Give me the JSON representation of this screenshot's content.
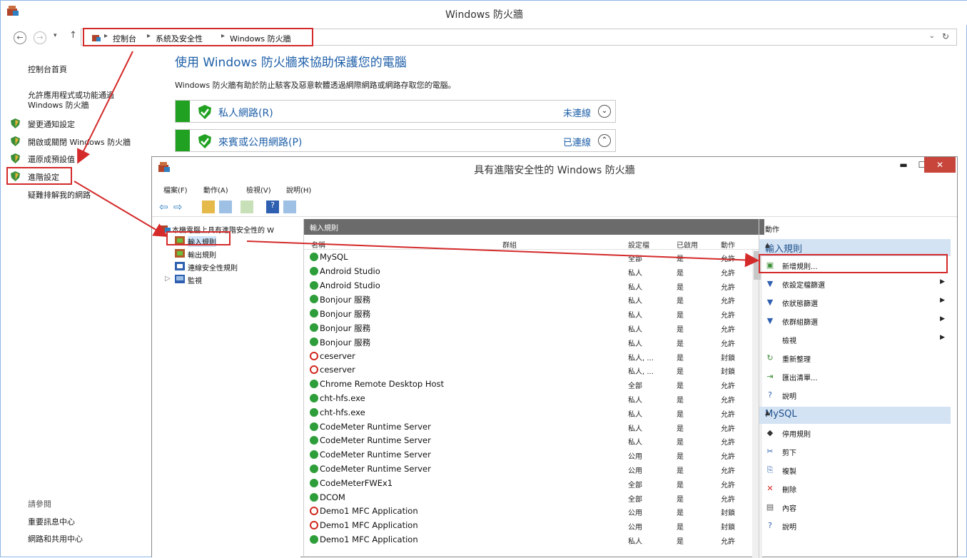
{
  "outer_window": {
    "title": "Windows 防火牆",
    "breadcrumb": [
      "控制台",
      "系統及安全性",
      "Windows 防火牆"
    ],
    "left_nav": {
      "home": "控制台首頁",
      "allow_app": "允許應用程式或功能通過 Windows 防火牆",
      "change_notify": "變更通知設定",
      "toggle_fw": "開啟或關閉 Windows 防火牆",
      "restore": "還原成預設值",
      "advanced": "進階設定",
      "troubleshoot": "疑難排解我的網路",
      "see_also": "請參閱",
      "security_center": "重要訊息中心",
      "network_center": "網路和共用中心"
    },
    "heading": "使用 Windows 防火牆來協助保護您的電腦",
    "description": "Windows 防火牆有助於防止駭客及惡意軟體透過網際網路或網路存取您的電腦。",
    "networks": [
      {
        "name": "私人網路(R)",
        "status": "未連線",
        "chevron": "⌄"
      },
      {
        "name": "來賓或公用網路(P)",
        "status": "已連線",
        "chevron": "⌃"
      }
    ]
  },
  "inner_window": {
    "title": "具有進階安全性的 Windows 防火牆",
    "menus": [
      "檔案(F)",
      "動作(A)",
      "檢視(V)",
      "說明(H)"
    ],
    "tree": {
      "root": "本機電腦上具有進階安全性的 W",
      "inbound": "輸入規則",
      "outbound": "輸出規則",
      "connection": "連線安全性規則",
      "monitor": "監視"
    },
    "rules_header": "輸入規則",
    "columns": {
      "name": "名稱",
      "group": "群組",
      "profile": "設定檔",
      "enabled": "已啟用",
      "action": "動作"
    },
    "rules": [
      {
        "name": "MySQL",
        "profile": "全部",
        "enabled": "是",
        "action": "允許",
        "type": "allow"
      },
      {
        "name": "Android Studio",
        "profile": "私人",
        "enabled": "是",
        "action": "允許",
        "type": "allow"
      },
      {
        "name": "Android Studio",
        "profile": "私人",
        "enabled": "是",
        "action": "允許",
        "type": "allow"
      },
      {
        "name": "Bonjour 服務",
        "profile": "私人",
        "enabled": "是",
        "action": "允許",
        "type": "allow"
      },
      {
        "name": "Bonjour 服務",
        "profile": "私人",
        "enabled": "是",
        "action": "允許",
        "type": "allow"
      },
      {
        "name": "Bonjour 服務",
        "profile": "私人",
        "enabled": "是",
        "action": "允許",
        "type": "allow"
      },
      {
        "name": "Bonjour 服務",
        "profile": "私人",
        "enabled": "是",
        "action": "允許",
        "type": "allow"
      },
      {
        "name": "ceserver",
        "profile": "私人, ...",
        "enabled": "是",
        "action": "封鎖",
        "type": "block"
      },
      {
        "name": "ceserver",
        "profile": "私人, ...",
        "enabled": "是",
        "action": "封鎖",
        "type": "block"
      },
      {
        "name": "Chrome Remote Desktop Host",
        "profile": "全部",
        "enabled": "是",
        "action": "允許",
        "type": "allow"
      },
      {
        "name": "cht-hfs.exe",
        "profile": "私人",
        "enabled": "是",
        "action": "允許",
        "type": "allow"
      },
      {
        "name": "cht-hfs.exe",
        "profile": "私人",
        "enabled": "是",
        "action": "允許",
        "type": "allow"
      },
      {
        "name": "CodeMeter Runtime Server",
        "profile": "私人",
        "enabled": "是",
        "action": "允許",
        "type": "allow"
      },
      {
        "name": "CodeMeter Runtime Server",
        "profile": "私人",
        "enabled": "是",
        "action": "允許",
        "type": "allow"
      },
      {
        "name": "CodeMeter Runtime Server",
        "profile": "公用",
        "enabled": "是",
        "action": "允許",
        "type": "allow"
      },
      {
        "name": "CodeMeter Runtime Server",
        "profile": "公用",
        "enabled": "是",
        "action": "允許",
        "type": "allow"
      },
      {
        "name": "CodeMeterFWEx1",
        "profile": "全部",
        "enabled": "是",
        "action": "允許",
        "type": "allow"
      },
      {
        "name": "DCOM",
        "profile": "全部",
        "enabled": "是",
        "action": "允許",
        "type": "allow"
      },
      {
        "name": "Demo1 MFC Application",
        "profile": "公用",
        "enabled": "是",
        "action": "封鎖",
        "type": "block"
      },
      {
        "name": "Demo1 MFC Application",
        "profile": "公用",
        "enabled": "是",
        "action": "封鎖",
        "type": "block"
      },
      {
        "name": "Demo1 MFC Application",
        "profile": "私人",
        "enabled": "是",
        "action": "允許",
        "type": "allow"
      }
    ],
    "actions": {
      "header": "動作",
      "section1": "輸入規則",
      "items1": [
        {
          "label": "新增規則...",
          "icon": "new-rule-icon"
        },
        {
          "label": "依設定檔篩選",
          "icon": "filter-icon"
        },
        {
          "label": "依狀態篩選",
          "icon": "filter-icon"
        },
        {
          "label": "依群組篩選",
          "icon": "filter-icon"
        },
        {
          "label": "檢視",
          "icon": ""
        },
        {
          "label": "重新整理",
          "icon": "refresh-icon"
        },
        {
          "label": "匯出清單...",
          "icon": "export-icon"
        },
        {
          "label": "說明",
          "icon": "help-icon"
        }
      ],
      "section2": "MySQL",
      "items2": [
        {
          "label": "停用規則",
          "icon": "disable-icon"
        },
        {
          "label": "剪下",
          "icon": "cut-icon"
        },
        {
          "label": "複製",
          "icon": "copy-icon"
        },
        {
          "label": "刪除",
          "icon": "delete-icon"
        },
        {
          "label": "內容",
          "icon": "properties-icon"
        },
        {
          "label": "說明",
          "icon": "help-icon"
        }
      ]
    }
  },
  "colors": {
    "annotation": "#d42a2a",
    "link": "#1e5fa8",
    "green": "#21a121"
  }
}
